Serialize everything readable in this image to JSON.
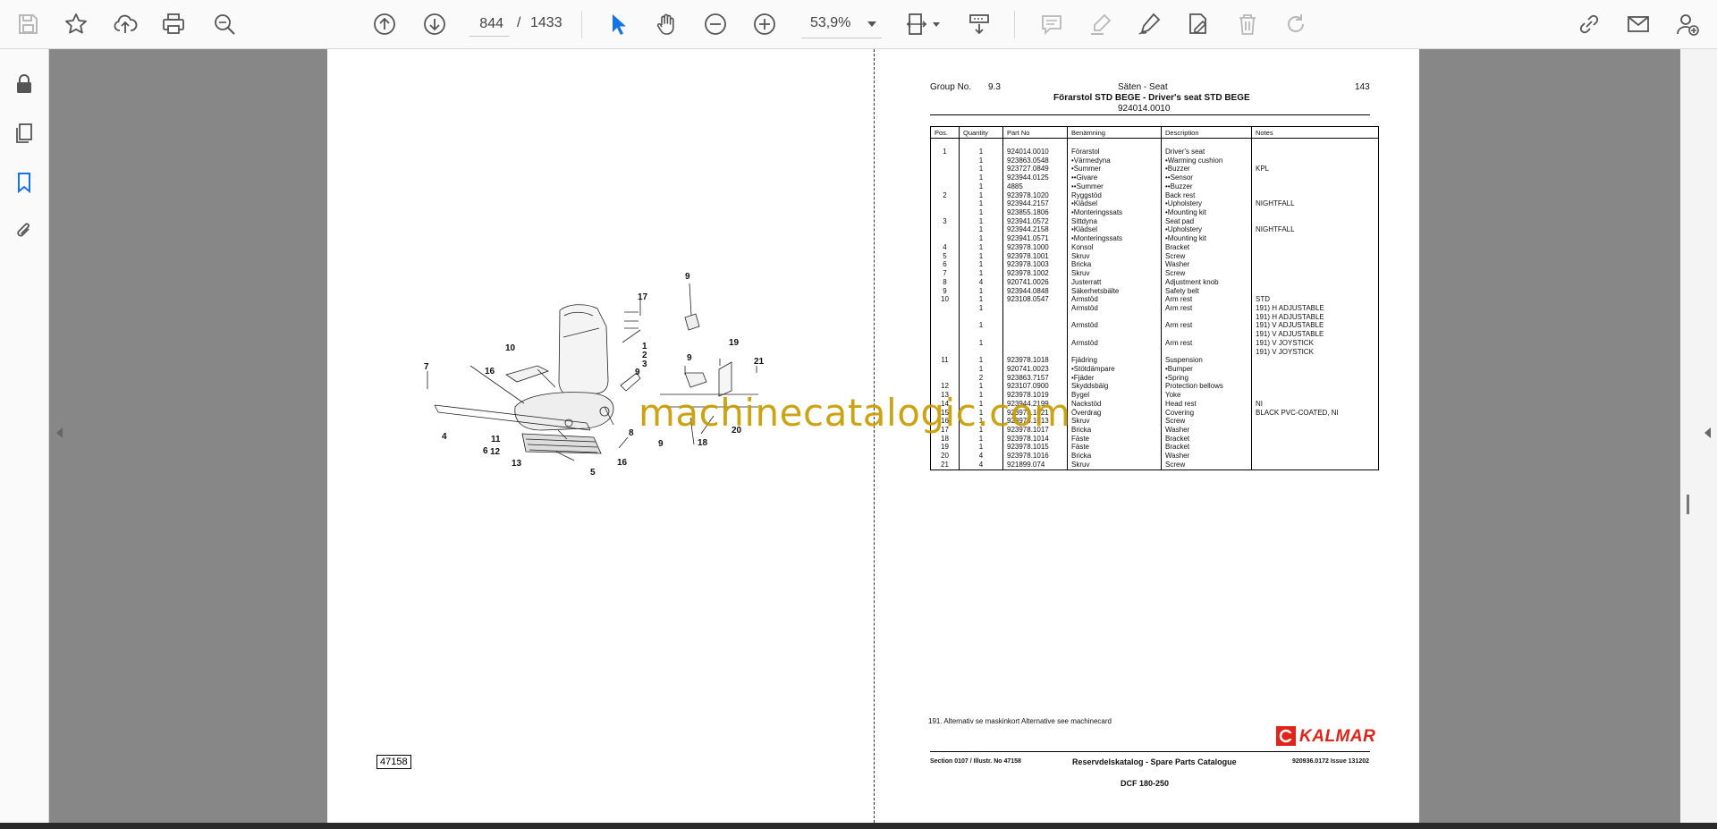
{
  "toolbar": {
    "current_page": "844",
    "page_separator": "/",
    "total_pages": "1433",
    "zoom": "53,9%"
  },
  "document": {
    "header": {
      "group_label": "Group No.",
      "group_no": "9.3",
      "section_title": "Säten - Seat",
      "page_no": "143",
      "title": "Förarstol STD BEGE - Driver's seat STD BEGE",
      "part_no": "924014.0010"
    },
    "table": {
      "headers": [
        "Pos.",
        "Quantity",
        "Part No",
        "Benämning",
        "Description",
        "Notes"
      ],
      "rows": [
        [
          "1",
          "1",
          "924014.0010",
          "Förarstol",
          "Driver's seat",
          ""
        ],
        [
          "",
          "1",
          "923863.0548",
          "•Värmedyna",
          "•Warming cushion",
          ""
        ],
        [
          "",
          "1",
          "923727.0849",
          "•Summer",
          "•Buzzer",
          "KPL"
        ],
        [
          "",
          "1",
          "923944.0125",
          "••Givare",
          "••Sensor",
          ""
        ],
        [
          "",
          "1",
          "4885",
          "••Summer",
          "••Buzzer",
          ""
        ],
        [
          "2",
          "1",
          "923978.1020",
          "Ryggstöd",
          "Back rest",
          ""
        ],
        [
          "",
          "1",
          "923944.2157",
          "•Klädsel",
          "•Upholstery",
          "NIGHTFALL"
        ],
        [
          "",
          "1",
          "923855.1806",
          "•Monteringssats",
          "•Mounting kit",
          ""
        ],
        [
          "3",
          "1",
          "923941.0572",
          "Sittdyna",
          "Seat pad",
          ""
        ],
        [
          "",
          "1",
          "923944.2158",
          "•Klädsel",
          "•Upholstery",
          "NIGHTFALL"
        ],
        [
          "",
          "1",
          "923941.0571",
          "•Monteringssats",
          "•Mounting kit",
          ""
        ],
        [
          "4",
          "1",
          "923978.1000",
          "Konsol",
          "Bracket",
          ""
        ],
        [
          "5",
          "1",
          "923978.1001",
          "Skruv",
          "Screw",
          ""
        ],
        [
          "6",
          "1",
          "923978.1003",
          "Bricka",
          "Washer",
          ""
        ],
        [
          "7",
          "1",
          "923978.1002",
          "Skruv",
          "Screw",
          ""
        ],
        [
          "8",
          "4",
          "920741.0026",
          "Justerratt",
          "Adjustment knob",
          ""
        ],
        [
          "9",
          "1",
          "923944.0848",
          "Säkerhetsbälte",
          "Safety belt",
          ""
        ],
        [
          "10",
          "1",
          "923108.0547",
          "Armstöd",
          "Arm rest",
          "STD"
        ],
        [
          "",
          "1",
          "",
          "Armstöd",
          "Arm rest",
          "191) H ADJUSTABLE"
        ],
        [
          "",
          "",
          "",
          "",
          "",
          "191) H ADJUSTABLE"
        ],
        [
          "",
          "1",
          "",
          "Armstöd",
          "Arm rest",
          "191) V ADJUSTABLE"
        ],
        [
          "",
          "",
          "",
          "",
          "",
          "191) V ADJUSTABLE"
        ],
        [
          "",
          "1",
          "",
          "Armstöd",
          "Arm rest",
          "191) V JOYSTICK"
        ],
        [
          "",
          "",
          "",
          "",
          "",
          "191) V JOYSTICK"
        ],
        [
          "11",
          "1",
          "923978.1018",
          "Fjädring",
          "Suspension",
          ""
        ],
        [
          "",
          "1",
          "920741.0023",
          "•Stötdämpare",
          "•Bumper",
          ""
        ],
        [
          "",
          "2",
          "923863.7157",
          "•Fjäder",
          "•Spring",
          ""
        ],
        [
          "12",
          "1",
          "923107.0900",
          "Skyddsbälg",
          "Protection bellows",
          ""
        ],
        [
          "13",
          "1",
          "923978.1019",
          "Bygel",
          "Yoke",
          ""
        ],
        [
          "14",
          "1",
          "923944.2199",
          "Nackstöd",
          "Head rest",
          "NI"
        ],
        [
          "15",
          "1",
          "923978.1021",
          "Överdrag",
          "Covering",
          "BLACK PVC-COATED, NI"
        ],
        [
          "16",
          "1",
          "923978.1013",
          "Skruv",
          "Screw",
          ""
        ],
        [
          "17",
          "1",
          "923978.1017",
          "Bricka",
          "Washer",
          ""
        ],
        [
          "18",
          "1",
          "923978.1014",
          "Fäste",
          "Bracket",
          ""
        ],
        [
          "19",
          "1",
          "923978.1015",
          "Fäste",
          "Bracket",
          ""
        ],
        [
          "20",
          "4",
          "923978.1016",
          "Bricka",
          "Washer",
          ""
        ],
        [
          "21",
          "4",
          "921899.074",
          "Skruv",
          "Screw",
          ""
        ]
      ]
    },
    "footnote": "191.   Alternativ se maskinkort     Alternative see machinecard",
    "footer": {
      "section": "Section  0107 / Illustr. No    47158",
      "catalogue": "Reservdelskatalog - Spare Parts Catalogue",
      "doc_code": "920936.0172 Issue 131202",
      "model": "DCF 180-250"
    },
    "illustration_number": "47158",
    "brand": "KALMAR",
    "watermark": "machinecatalogic.com",
    "callouts": [
      "9",
      "17",
      "1",
      "2",
      "3",
      "10",
      "16",
      "7",
      "9",
      "9",
      "19",
      "21",
      "4",
      "11",
      "6",
      "12",
      "13",
      "8",
      "9",
      "18",
      "20",
      "5",
      "16"
    ]
  },
  "colors": {
    "toolbar_bg": "#fafafa",
    "doc_bg": "#878787",
    "accent_blue": "#1473e6",
    "kalmar_red": "#e2231a",
    "watermark": "#c89c00"
  }
}
